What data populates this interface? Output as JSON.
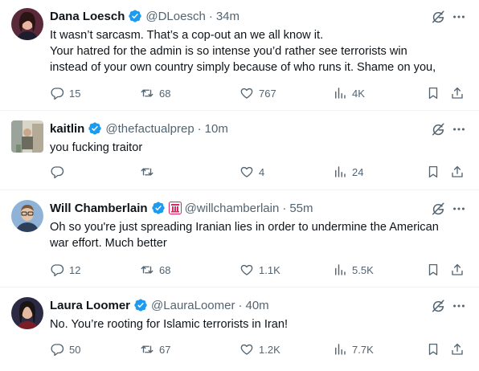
{
  "tweets": [
    {
      "name": "Dana Loesch",
      "handle": "@DLoesch",
      "separator": "·",
      "time": "34m",
      "lines": [
        "It wasn’t sarcasm. That’s a cop-out an we all know it.",
        "Your hatred for the admin is so intense you’d rather see terrorists win",
        "instead of your own country simply because of who runs it. Shame on you,"
      ],
      "replies": "15",
      "reposts": "68",
      "likes": "767",
      "views": "4K",
      "avatar_colors": [
        "#5a2a3a",
        "#e7b7a1"
      ]
    },
    {
      "name": "kaitlin",
      "handle": "@thefactualprep",
      "separator": "·",
      "time": "10m",
      "lines": [
        "you fucking traitor"
      ],
      "replies": "",
      "reposts": "",
      "likes": "4",
      "views": "24",
      "avatar_colors": [
        "#9aa49a",
        "#d8d6c8"
      ]
    },
    {
      "name": "Will Chamberlain",
      "handle": "@willchamberlain",
      "separator": "·",
      "time": "55m",
      "lines": [
        "Oh so you're just spreading Iranian lies in order to undermine the American",
        "war effort. Much better"
      ],
      "replies": "12",
      "reposts": "68",
      "likes": "1.1K",
      "views": "5.5K",
      "avatar_colors": [
        "#8fb3d6",
        "#e8c4a8"
      ]
    },
    {
      "name": "Laura Loomer",
      "handle": "@LauraLoomer",
      "separator": "·",
      "time": "40m",
      "lines": [
        "No. You’re rooting for Islamic terrorists in Iran!"
      ],
      "replies": "50",
      "reposts": "67",
      "likes": "1.2K",
      "views": "7.7K",
      "avatar_colors": [
        "#2b2a44",
        "#e4b9a2"
      ]
    }
  ],
  "colors": {
    "verified": "#1d9bf0",
    "text": "#0f1419",
    "muted": "#536471",
    "divider": "#eff3f4",
    "affiliation": "#e0245e"
  }
}
